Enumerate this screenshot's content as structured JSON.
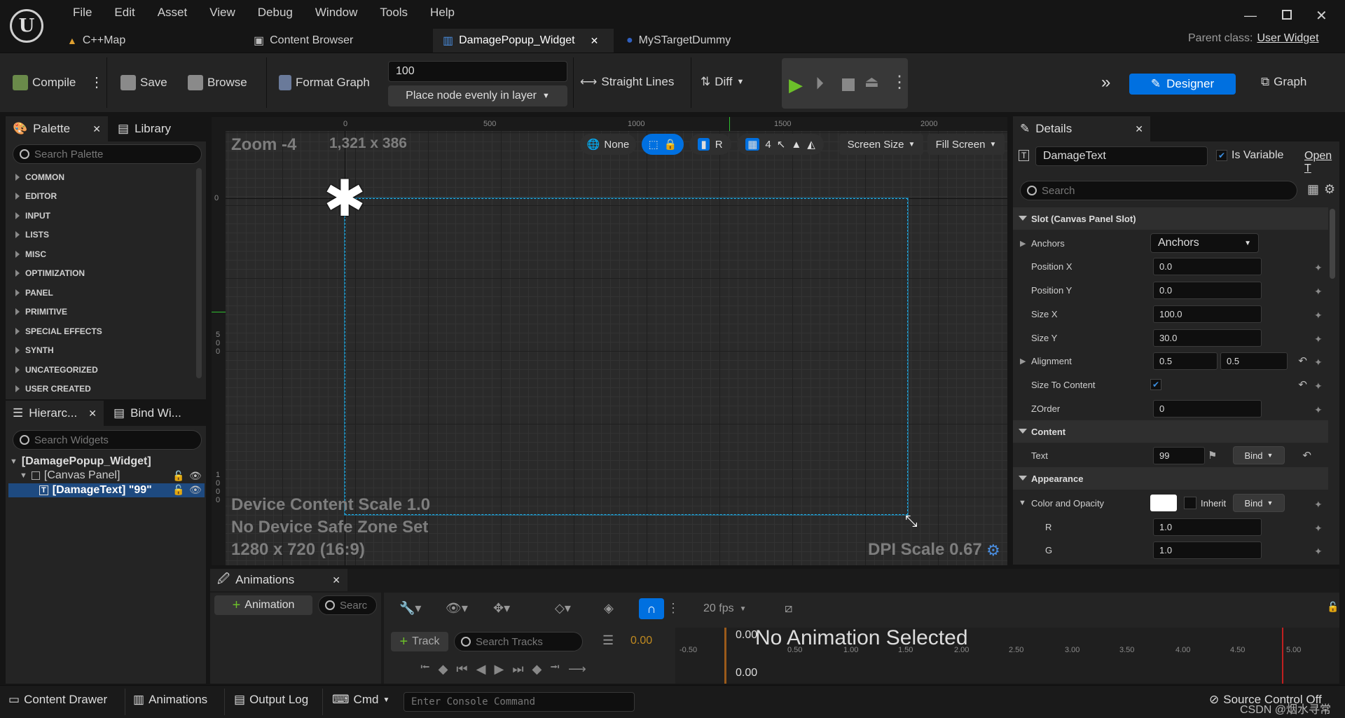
{
  "menu": [
    "File",
    "Edit",
    "Asset",
    "View",
    "Debug",
    "Window",
    "Tools",
    "Help"
  ],
  "tabs": [
    {
      "label": "C++Map"
    },
    {
      "label": "Content Browser"
    },
    {
      "label": "DamagePopup_Widget"
    },
    {
      "label": "MySTargetDummy"
    }
  ],
  "parent_class": {
    "label": "Parent class:",
    "value": "User Widget"
  },
  "toolbar": {
    "compile": "Compile",
    "save": "Save",
    "browse": "Browse",
    "format_graph": "Format Graph",
    "spacing_value": "100",
    "layer_option": "Place node evenly in layer",
    "straight_lines": "Straight Lines",
    "diff": "Diff",
    "designer": "Designer",
    "graph": "Graph"
  },
  "palette": {
    "tab": "Palette",
    "library_tab": "Library",
    "search_placeholder": "Search Palette",
    "categories": [
      "COMMON",
      "EDITOR",
      "INPUT",
      "LISTS",
      "MISC",
      "OPTIMIZATION",
      "PANEL",
      "PRIMITIVE",
      "SPECIAL EFFECTS",
      "SYNTH",
      "UNCATEGORIZED",
      "USER CREATED"
    ]
  },
  "hierarchy": {
    "tab": "Hierarc...",
    "bind_tab": "Bind Wi...",
    "search_placeholder": "Search Widgets",
    "root": "[DamagePopup_Widget]",
    "canvas": "[Canvas Panel]",
    "item": "[DamageText] \"99\""
  },
  "designer": {
    "zoom": "Zoom -4",
    "size": "1,321 x 386",
    "none_label": "None",
    "r_label": "R",
    "grid_count": "4",
    "screen_size": "Screen Size",
    "fill_screen": "Fill Screen",
    "ruler_top": [
      "0",
      "500",
      "1000",
      "1500",
      "2000"
    ],
    "ruler_left": [
      "0",
      "500",
      "1000"
    ],
    "content_scale": "Device Content Scale 1.0",
    "safe_zone": "No Device Safe Zone Set",
    "resolution": "1280 x 720 (16:9)",
    "dpi": "DPI Scale 0.67"
  },
  "details": {
    "tab": "Details",
    "widget_name": "DamageText",
    "is_variable": "Is Variable",
    "open": "Open T",
    "search_placeholder": "Search",
    "slot_section": "Slot (Canvas Panel Slot)",
    "anchors_label": "Anchors",
    "anchors_value": "Anchors",
    "position_x": {
      "label": "Position X",
      "value": "0.0"
    },
    "position_y": {
      "label": "Position Y",
      "value": "0.0"
    },
    "size_x": {
      "label": "Size X",
      "value": "100.0"
    },
    "size_y": {
      "label": "Size Y",
      "value": "30.0"
    },
    "alignment": {
      "label": "Alignment",
      "x": "0.5",
      "y": "0.5"
    },
    "size_to_content": {
      "label": "Size To Content",
      "checked": true
    },
    "zorder": {
      "label": "ZOrder",
      "value": "0"
    },
    "content_section": "Content",
    "text": {
      "label": "Text",
      "value": "99",
      "bind": "Bind"
    },
    "appearance_section": "Appearance",
    "color_opacity": {
      "label": "Color and Opacity",
      "inherit": "Inherit",
      "bind": "Bind",
      "color": "#ffffff"
    },
    "r": {
      "label": "R",
      "value": "1.0"
    },
    "g": {
      "label": "G",
      "value": "1.0"
    }
  },
  "animations": {
    "tab": "Animations",
    "add": "Animation",
    "search": "Searc",
    "track": "Track",
    "search_tracks": "Search Tracks",
    "time": "0.00",
    "fps": "20 fps",
    "no_anim": "No Animation Selected",
    "playhead": "0.00",
    "time_bottom": "0.00",
    "ticks": [
      "0.50",
      "1.00",
      "1.50",
      "2.00",
      "2.50",
      "3.00",
      "3.50",
      "4.00",
      "4.50",
      "5.00"
    ],
    "neg": "-0.50"
  },
  "bottom": {
    "content_drawer": "Content Drawer",
    "animations": "Animations",
    "output_log": "Output Log",
    "cmd": "Cmd",
    "console_placeholder": "Enter Console Command",
    "source_control": "Source Control Off",
    "watermark": "CSDN @烟水寻常"
  },
  "colors": {
    "accent": "#0070e0",
    "selection": "#1fa8e0",
    "play": "#6cbf2a"
  }
}
